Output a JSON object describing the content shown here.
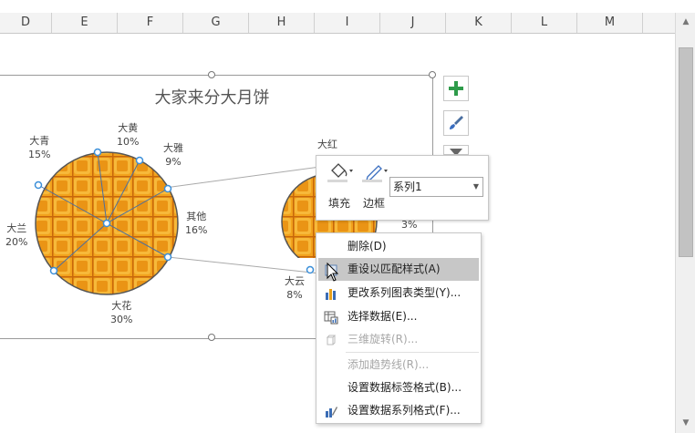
{
  "columns": [
    "D",
    "E",
    "F",
    "G",
    "H",
    "I",
    "J",
    "K",
    "L",
    "M"
  ],
  "chart": {
    "title": "大家来分大月饼",
    "left_labels": [
      {
        "name": "大青",
        "pct": "15%"
      },
      {
        "name": "大黄",
        "pct": "10%"
      },
      {
        "name": "大雅",
        "pct": "9%"
      },
      {
        "name": "其他",
        "pct": "16%"
      },
      {
        "name": "大花",
        "pct": "30%"
      },
      {
        "name": "大兰",
        "pct": "20%"
      }
    ],
    "right_labels": [
      {
        "name": "大红",
        "pct": ""
      },
      {
        "name": "",
        "pct": "3%"
      },
      {
        "name": "大云",
        "pct": "8%"
      }
    ]
  },
  "chart_data": {
    "type": "pie",
    "title": "大家来分大月饼",
    "main_pie": [
      {
        "label": "大花",
        "value": 30
      },
      {
        "label": "大兰",
        "value": 20
      },
      {
        "label": "大青",
        "value": 15
      },
      {
        "label": "大黄",
        "value": 10
      },
      {
        "label": "大雅",
        "value": 9
      },
      {
        "label": "其他",
        "value": 16
      }
    ],
    "secondary_pie_visible": [
      {
        "label": "大红",
        "value": null
      },
      {
        "label": "",
        "value": 3
      },
      {
        "label": "大云",
        "value": 8
      }
    ]
  },
  "side_buttons": [
    "plus-icon",
    "brush-icon",
    "filter-icon"
  ],
  "format_toolbar": {
    "fill_label": "填充",
    "border_label": "边框",
    "series_select": "系列1"
  },
  "context_menu": {
    "items": [
      {
        "label": "删除(D)",
        "icon": "none",
        "state": "normal"
      },
      {
        "label": "重设以匹配样式(A)",
        "icon": "reset-style-icon",
        "state": "highlighted"
      },
      {
        "label": "更改系列图表类型(Y)...",
        "icon": "bar-chart-icon",
        "state": "normal"
      },
      {
        "label": "选择数据(E)...",
        "icon": "select-data-icon",
        "state": "normal"
      },
      {
        "label": "三维旋转(R)...",
        "icon": "cube-icon",
        "state": "disabled"
      },
      {
        "label": "添加趋势线(R)...",
        "icon": "none",
        "state": "disabled"
      },
      {
        "label": "设置数据标签格式(B)...",
        "icon": "none",
        "state": "normal"
      },
      {
        "label": "设置数据系列格式(F)...",
        "icon": "format-series-icon",
        "state": "normal"
      }
    ]
  },
  "colors": {
    "pie_orange": "#f2a21c",
    "pie_dark": "#c8670a",
    "handle_blue": "#3b8fd9",
    "menu_highlight": "#c7c7c7",
    "plus_green": "#2e9b4a"
  }
}
